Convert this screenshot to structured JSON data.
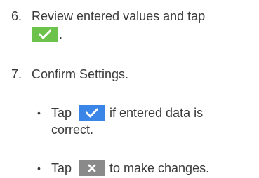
{
  "steps": [
    {
      "number": "6.",
      "line1": "Review entered values and tap",
      "line2_tail": ".",
      "icon": "check-icon",
      "icon_color": "#6cc24a"
    },
    {
      "number": "7.",
      "text": "Confirm Settings.",
      "bullets": [
        {
          "marker": "•",
          "prefix": "Tap",
          "icon": "check-icon",
          "icon_color": "#3a86e8",
          "suffix": "if entered data is",
          "line2": "correct."
        },
        {
          "marker": "•",
          "prefix": "Tap",
          "icon": "close-icon",
          "icon_color": "#8a8a8a",
          "suffix": "to make changes."
        }
      ]
    }
  ],
  "colors": {
    "text": "#3a3a3a",
    "check_green": "#6cc24a",
    "check_blue": "#3a86e8",
    "close_gray": "#8a8a8a"
  }
}
